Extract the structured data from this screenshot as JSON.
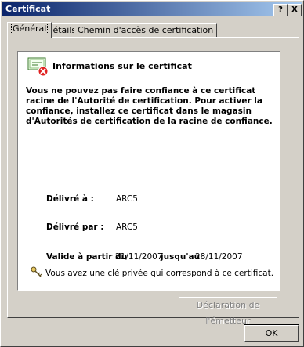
{
  "window": {
    "title": "Certificat",
    "help_label": "?",
    "close_label": "X"
  },
  "tabs": [
    {
      "label": "Général",
      "active": true
    },
    {
      "label": "Détails",
      "active": false
    },
    {
      "label": "Chemin d'accès de certification",
      "active": false
    }
  ],
  "info": {
    "title": "Informations sur le certificat",
    "warning": "Vous ne pouvez pas faire confiance à ce certificat racine de l'Autorité de certification. Pour activer la confiance, installez ce certificat dans le magasin d'Autorités de certification de la racine de confiance.",
    "issued_to_label": "Délivré à :",
    "issued_to_value": "ARC5",
    "issued_by_label": "Délivré par :",
    "issued_by_value": "ARC5",
    "valid_from_label": "Valide à partir du",
    "valid_from_value": "21/11/2007",
    "valid_to_label": "jusqu'au",
    "valid_to_value": "28/11/2007",
    "private_key_text": "Vous avez une clé privée qui correspond à ce certificat."
  },
  "buttons": {
    "issuer_statement": "Déclaration de l'émetteur",
    "ok": "OK"
  },
  "icons": {
    "certificate": "certificate-error-icon",
    "key": "key-icon"
  },
  "colors": {
    "titlebar_start": "#0a246a",
    "titlebar_end": "#a6caf0",
    "error_red": "#e02020"
  }
}
